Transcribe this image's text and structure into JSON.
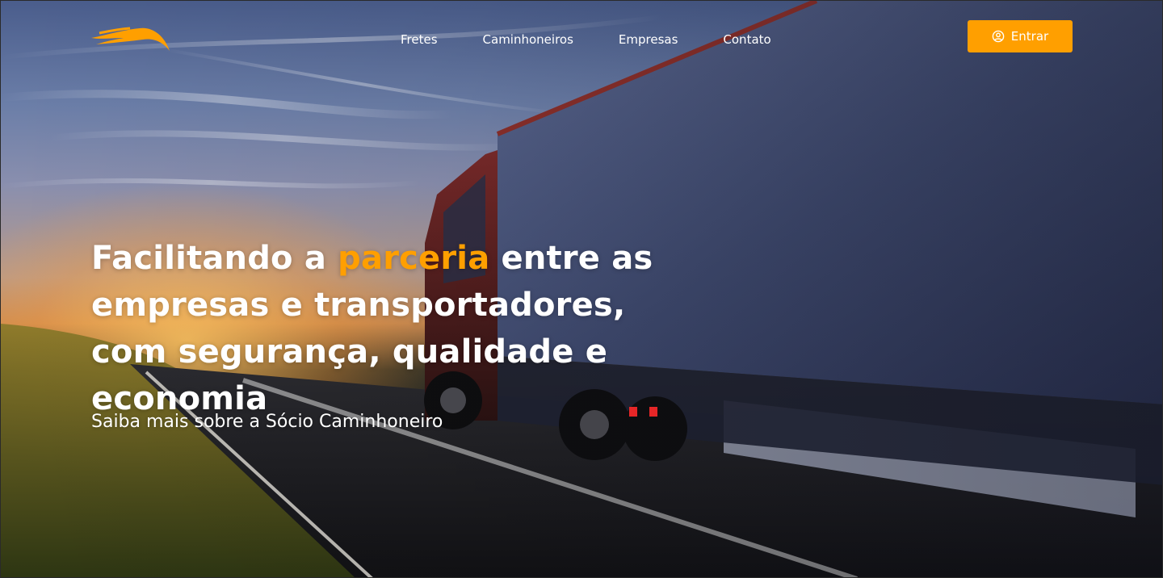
{
  "nav": {
    "items": [
      {
        "label": "Fretes"
      },
      {
        "label": "Caminhoneiros"
      },
      {
        "label": "Empresas"
      },
      {
        "label": "Contato"
      }
    ],
    "login_label": "Entrar"
  },
  "hero": {
    "headline_before": "Facilitando a ",
    "headline_accent": "parceria",
    "headline_after": " entre as empresas e transportadores, com segurança, qualidade e economia",
    "sublink": "Saiba mais sobre a Sócio Caminhoneiro"
  },
  "theme": {
    "accent": "#ff9f00",
    "text": "#ffffff"
  },
  "icons": {
    "logo": "eagle-logo",
    "login": "user-circle-icon"
  }
}
